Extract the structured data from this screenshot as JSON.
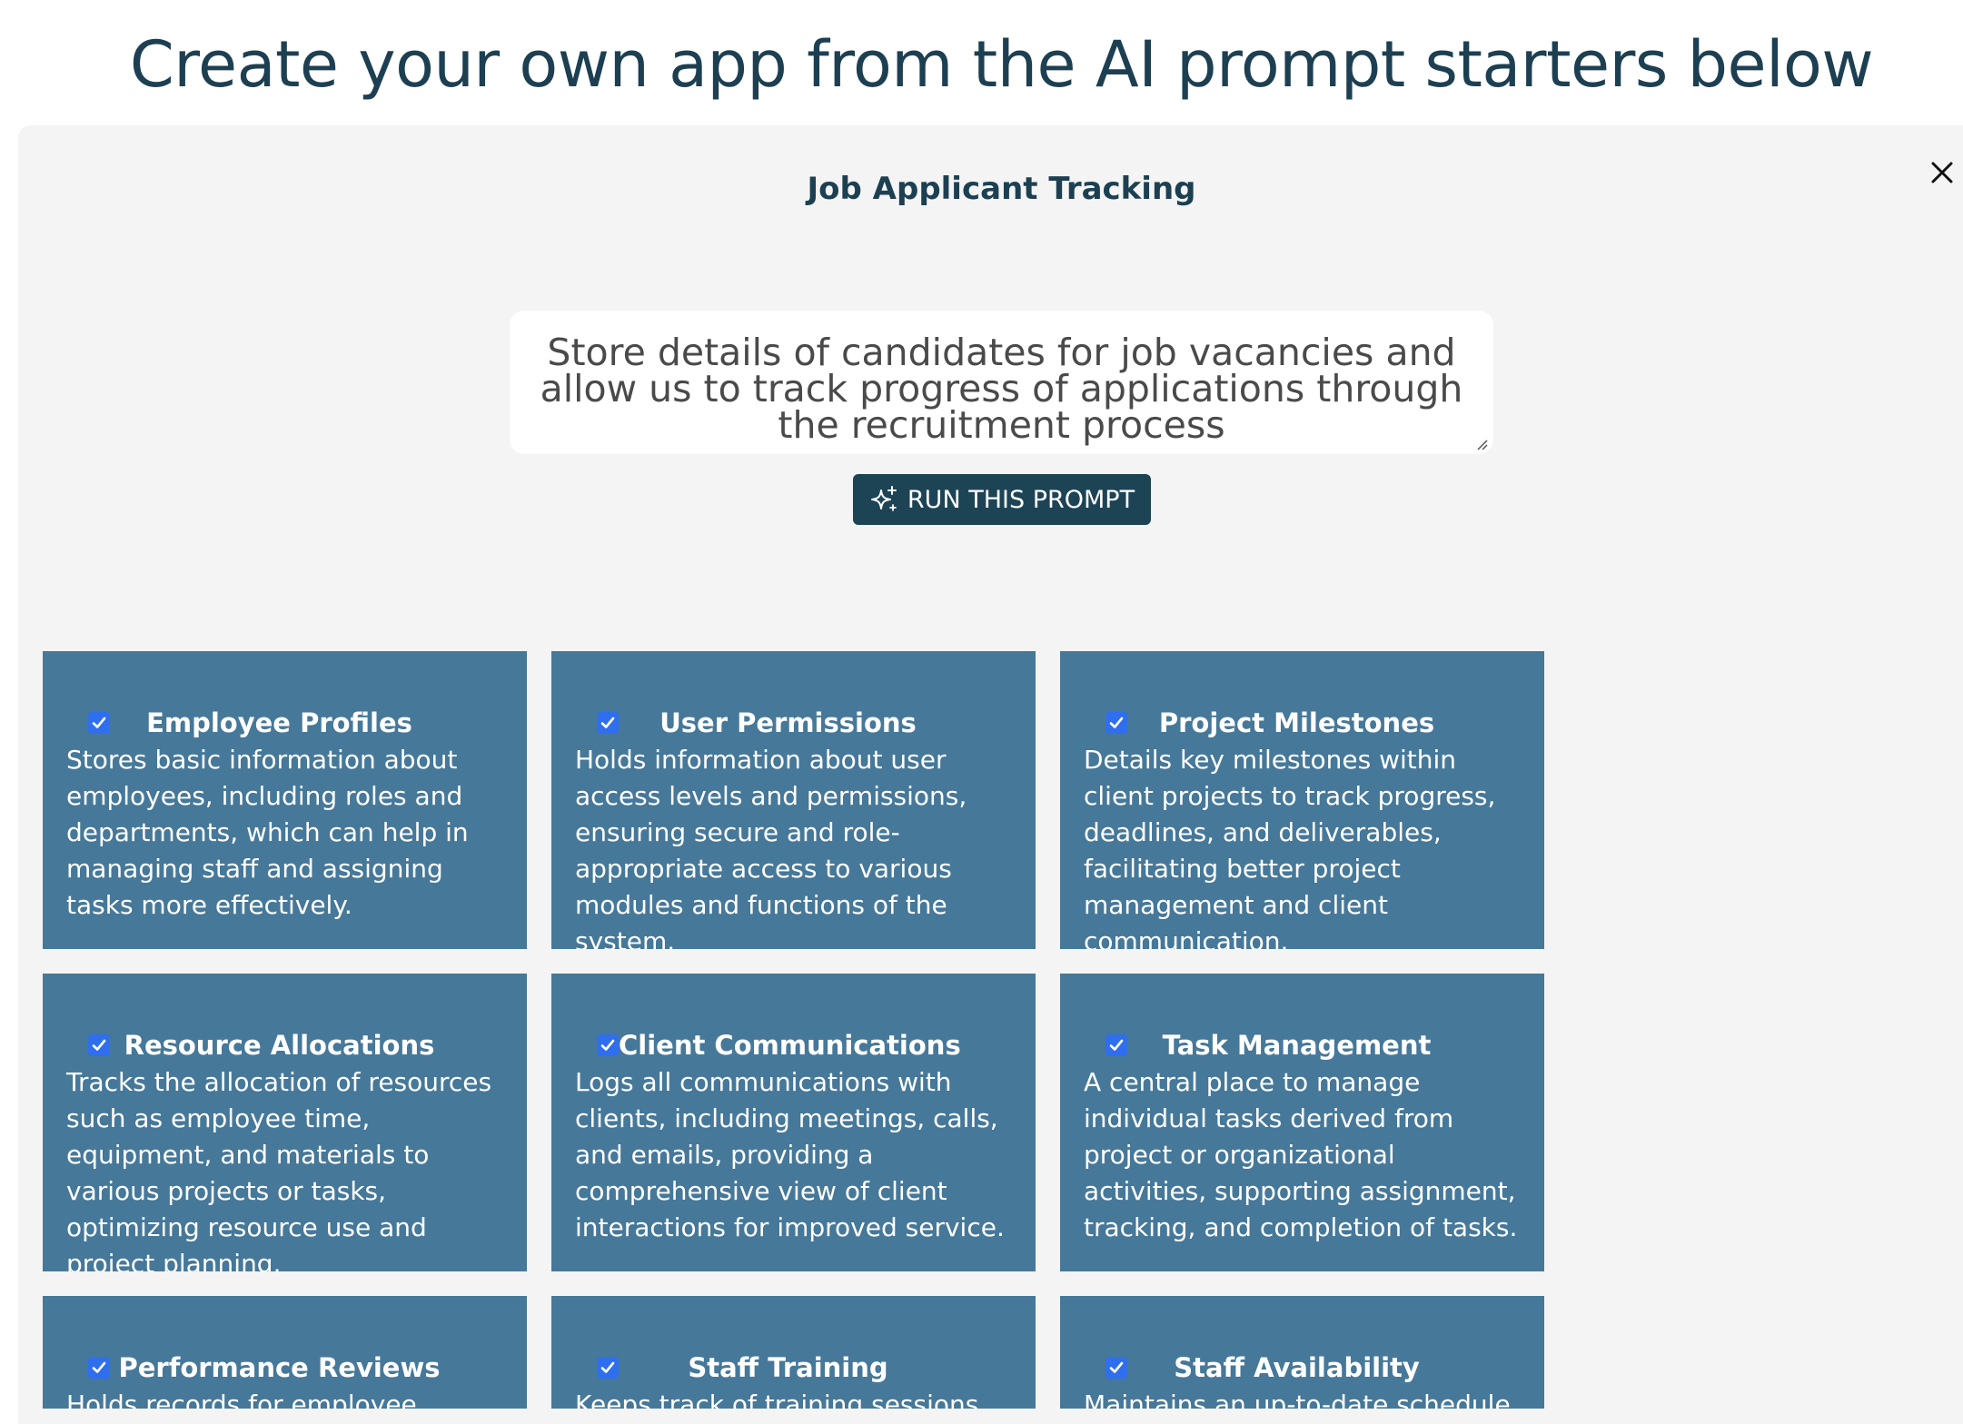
{
  "page": {
    "heading": "Create your own app from the AI prompt starters below"
  },
  "panel": {
    "title": "Job Applicant Tracking",
    "prompt_text": "Store details of candidates for job vacancies and allow us to track progress of applications through the recruitment process",
    "run_button_label": "RUN THIS PROMPT",
    "run_button_icon": "sparkles-icon",
    "close_icon": "close-icon"
  },
  "colors": {
    "heading_text": "#1d3f52",
    "panel_bg": "#f3f4f3",
    "card_bg": "#467899",
    "button_bg": "#1d4455",
    "checkbox": "#2f6fef"
  },
  "cards": [
    {
      "title": "Employee Profiles",
      "checked": true,
      "description": "Stores basic information about employees, including roles and departments, which can help in managing staff and assigning tasks more effectively."
    },
    {
      "title": "User Permissions",
      "checked": true,
      "description": "Holds information about user access levels and permissions, ensuring secure and role-appropriate access to various modules and functions of the system."
    },
    {
      "title": "Project Milestones",
      "checked": true,
      "description": "Details key milestones within client projects to track progress, deadlines, and deliverables, facilitating better project management and client communication."
    },
    {
      "title": "Resource Allocations",
      "checked": true,
      "description": "Tracks the allocation of resources such as employee time, equipment, and materials to various projects or tasks, optimizing resource use and project planning."
    },
    {
      "title": "Client Communications",
      "checked": true,
      "description": "Logs all communications with clients, including meetings, calls, and emails, providing a comprehensive view of client interactions for improved service."
    },
    {
      "title": "Task Management",
      "checked": true,
      "description": "A central place to manage individual tasks derived from project or organizational activities, supporting assignment, tracking, and completion of tasks."
    },
    {
      "title": "Performance Reviews",
      "checked": true,
      "description": "Holds records for employee"
    },
    {
      "title": "Staff Training",
      "checked": true,
      "description": "Keeps track of training sessions"
    },
    {
      "title": "Staff Availability",
      "checked": true,
      "description": "Maintains an up-to-date schedule of"
    }
  ]
}
